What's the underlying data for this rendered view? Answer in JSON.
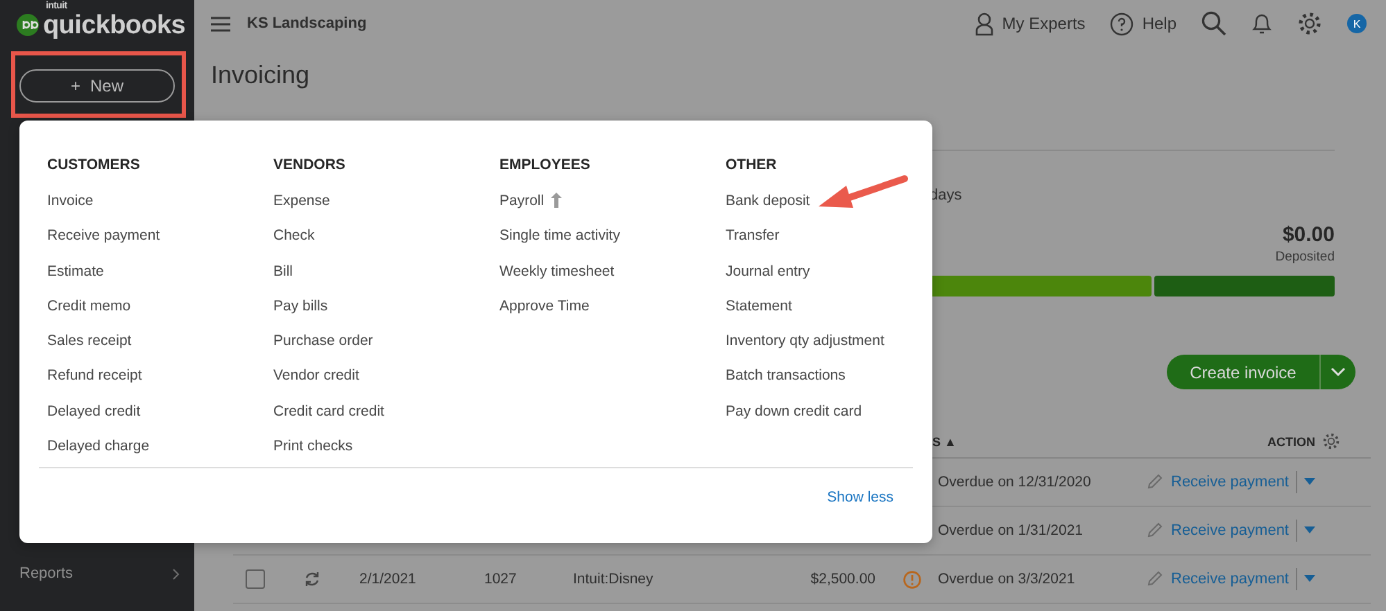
{
  "sidebar": {
    "logo_small": "intuit",
    "logo": "quickbooks",
    "new_button": {
      "label": "New",
      "icon": "+",
      "highlighted": true
    },
    "items": [
      {
        "label": "Reports",
        "selected": false
      }
    ]
  },
  "header": {
    "company": "KS Landscaping",
    "actions": [
      "My Experts",
      "Help"
    ],
    "avatar": "K"
  },
  "page": {
    "title": "Invoicing"
  },
  "summary": {
    "period": "days",
    "amount": "$0.00",
    "amount_label": "Deposited",
    "bars": [
      {
        "color": "#4c860c",
        "level": 0.55
      },
      {
        "color": "#1e5e14",
        "level": 0.45
      }
    ]
  },
  "create_button": "Create invoice",
  "table": {
    "status_column": "S",
    "sort": "▲",
    "action_column": "ACTION",
    "rows": [
      {
        "status": "Overdue on 12/31/2020",
        "action": "Receive payment"
      },
      {
        "status": "Overdue on 1/31/2021",
        "action": "Receive payment"
      },
      {
        "checked": false,
        "date": "2/1/2021",
        "number": "1027",
        "customer": "Intuit:Disney",
        "amount": "$2,500.00",
        "status": "Overdue on 3/3/2021",
        "action": "Receive payment"
      }
    ]
  },
  "new_menu": {
    "sections": [
      {
        "title": "CUSTOMERS",
        "items": [
          {
            "label": "Invoice",
            "upgrade": false
          },
          {
            "label": "Receive payment",
            "upgrade": false
          },
          {
            "label": "Estimate",
            "upgrade": false
          },
          {
            "label": "Credit memo",
            "upgrade": false
          },
          {
            "label": "Sales receipt",
            "upgrade": false
          },
          {
            "label": "Refund receipt",
            "upgrade": false
          },
          {
            "label": "Delayed credit",
            "upgrade": false
          },
          {
            "label": "Delayed charge",
            "upgrade": false
          }
        ]
      },
      {
        "title": "VENDORS",
        "items": [
          {
            "label": "Expense",
            "upgrade": false
          },
          {
            "label": "Check",
            "upgrade": false
          },
          {
            "label": "Bill",
            "upgrade": false
          },
          {
            "label": "Pay bills",
            "upgrade": false
          },
          {
            "label": "Purchase order",
            "upgrade": false
          },
          {
            "label": "Vendor credit",
            "upgrade": false
          },
          {
            "label": "Credit card credit",
            "upgrade": false
          },
          {
            "label": "Print checks",
            "upgrade": false
          }
        ]
      },
      {
        "title": "EMPLOYEES",
        "items": [
          {
            "label": "Payroll",
            "upgrade": true
          },
          {
            "label": "Single time activity",
            "upgrade": false
          },
          {
            "label": "Weekly timesheet",
            "upgrade": false
          },
          {
            "label": "Approve Time",
            "upgrade": false
          }
        ]
      },
      {
        "title": "OTHER",
        "items": [
          {
            "label": "Bank deposit",
            "upgrade": false
          },
          {
            "label": "Transfer",
            "upgrade": false
          },
          {
            "label": "Journal entry",
            "upgrade": false
          },
          {
            "label": "Statement",
            "upgrade": false
          },
          {
            "label": "Inventory qty adjustment",
            "upgrade": false
          },
          {
            "label": "Batch transactions",
            "upgrade": false
          },
          {
            "label": "Pay down credit card",
            "upgrade": false
          }
        ]
      }
    ],
    "toggle": "Show less"
  }
}
